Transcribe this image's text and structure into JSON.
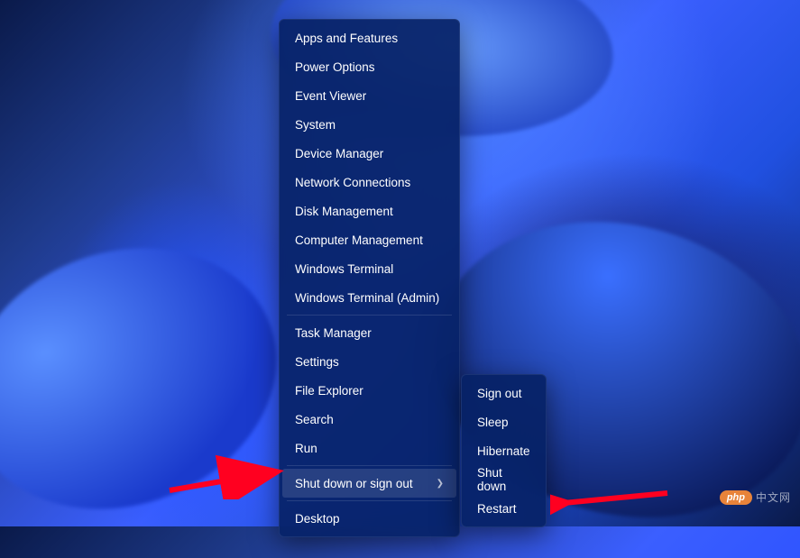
{
  "contextMenu": {
    "items": [
      {
        "label": "Apps and Features"
      },
      {
        "label": "Power Options"
      },
      {
        "label": "Event Viewer"
      },
      {
        "label": "System"
      },
      {
        "label": "Device Manager"
      },
      {
        "label": "Network Connections"
      },
      {
        "label": "Disk Management"
      },
      {
        "label": "Computer Management"
      },
      {
        "label": "Windows Terminal"
      },
      {
        "label": "Windows Terminal (Admin)"
      },
      {
        "label": "Task Manager"
      },
      {
        "label": "Settings"
      },
      {
        "label": "File Explorer"
      },
      {
        "label": "Search"
      },
      {
        "label": "Run"
      },
      {
        "label": "Shut down or sign out",
        "hasSubmenu": true,
        "highlighted": true
      },
      {
        "label": "Desktop"
      }
    ],
    "separatorsAfterIndex": [
      9,
      14,
      15
    ]
  },
  "submenu": {
    "items": [
      {
        "label": "Sign out"
      },
      {
        "label": "Sleep"
      },
      {
        "label": "Hibernate"
      },
      {
        "label": "Shut down"
      },
      {
        "label": "Restart"
      }
    ]
  },
  "annotations": {
    "arrowColor": "#ff0020"
  },
  "watermark": {
    "badge": "php",
    "text": "中文网"
  }
}
